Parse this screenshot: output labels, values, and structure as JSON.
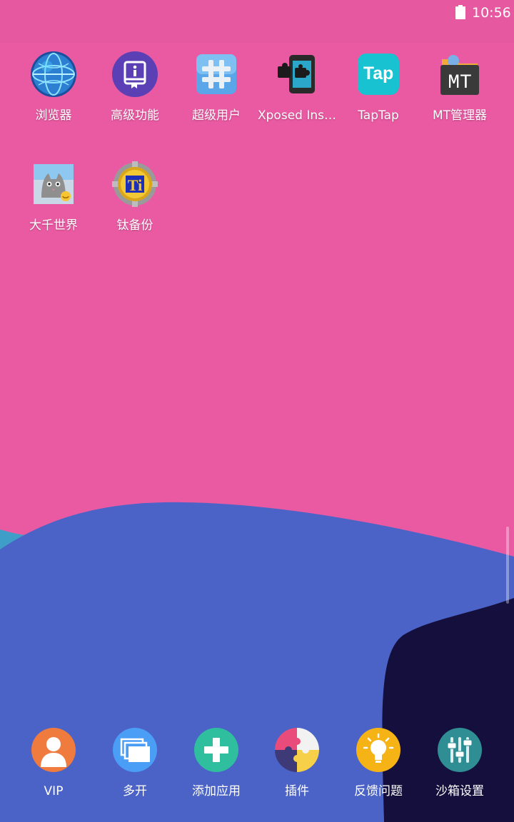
{
  "status_bar": {
    "time": "10:56"
  },
  "apps": [
    {
      "label": "浏览器",
      "icon": "globe-icon"
    },
    {
      "label": "高级功能",
      "icon": "info-book-icon"
    },
    {
      "label": "超级用户",
      "icon": "hash-icon"
    },
    {
      "label": "Xposed Inst…",
      "icon": "xposed-puzzle-icon"
    },
    {
      "label": "TapTap",
      "icon": "taptap-icon",
      "icon_text": "Tap"
    },
    {
      "label": "MT管理器",
      "icon": "mt-manager-icon",
      "icon_text": "MT"
    },
    {
      "label": "大千世界",
      "icon": "cat-photo-icon"
    },
    {
      "label": "钛备份",
      "icon": "titanium-backup-icon",
      "icon_text": "Ti"
    }
  ],
  "dock": [
    {
      "label": "VIP",
      "icon": "user-icon",
      "color": "#f07b3f"
    },
    {
      "label": "多开",
      "icon": "windows-stack-icon",
      "color": "#4a9ef5"
    },
    {
      "label": "添加应用",
      "icon": "plus-icon",
      "color": "#2fbf9f"
    },
    {
      "label": "插件",
      "icon": "puzzle-icon",
      "color": "#e94b7a"
    },
    {
      "label": "反馈问题",
      "icon": "lightbulb-icon",
      "color": "#f5b316"
    },
    {
      "label": "沙箱设置",
      "icon": "sliders-icon",
      "color": "#2f8e94"
    }
  ],
  "colors": {
    "wallpaper_pink": "#e95aa2",
    "wave_blue": "#4b63c6",
    "wave_teal": "#3f9ec8",
    "corner_navy": "#150f3e"
  }
}
